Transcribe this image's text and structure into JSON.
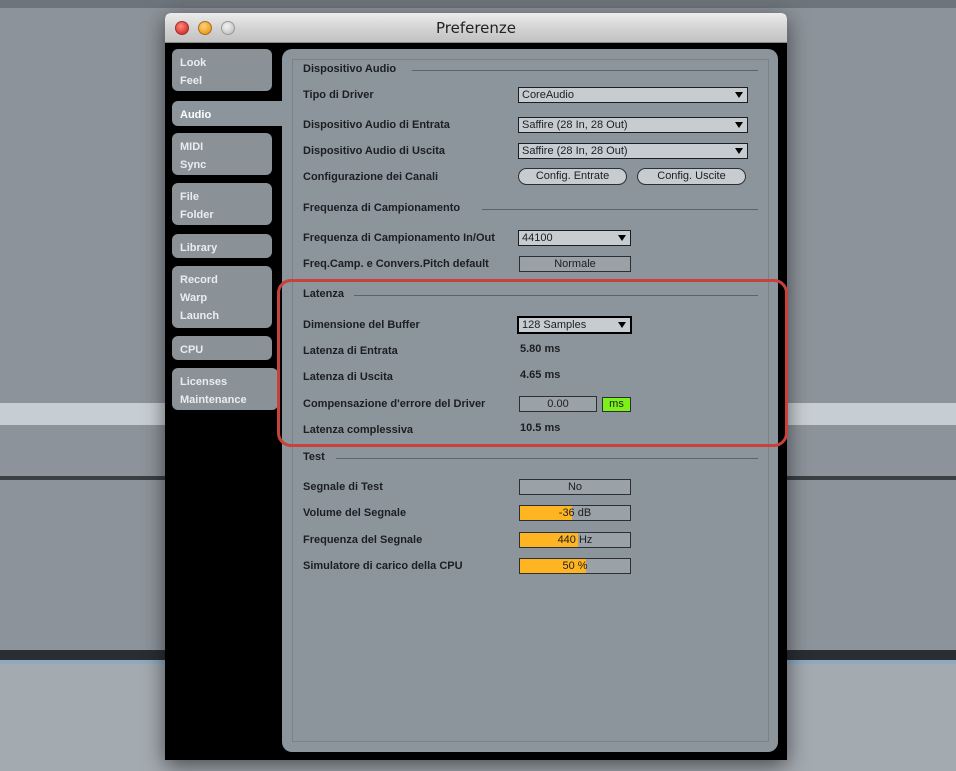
{
  "window": {
    "title": "Preferenze"
  },
  "sidebar": {
    "tabs": [
      {
        "lines": [
          "Look",
          "Feel"
        ]
      },
      {
        "lines": [
          "Audio"
        ]
      },
      {
        "lines": [
          "MIDI",
          "Sync"
        ]
      },
      {
        "lines": [
          "File",
          "Folder"
        ]
      },
      {
        "lines": [
          "Library"
        ]
      },
      {
        "lines": [
          "Record",
          "Warp",
          "Launch"
        ]
      },
      {
        "lines": [
          "CPU"
        ]
      },
      {
        "lines": [
          "Licenses"
        ]
      }
    ],
    "maintenance_label": "Maintenance",
    "active_tab": "Audio"
  },
  "device": {
    "section_title": "Dispositivo Audio",
    "driver_type_label": "Tipo di Driver",
    "driver_type_value": "CoreAudio",
    "input_device_label": "Dispositivo Audio di Entrata",
    "input_device_value": "Saffire (28 In, 28 Out)",
    "output_device_label": "Dispositivo Audio di Uscita",
    "output_device_value": "Saffire (28 In, 28 Out)",
    "channel_config_label": "Configurazione dei Canali",
    "input_config_button": "Config. Entrate",
    "output_config_button": "Config. Uscite"
  },
  "sample_rate": {
    "section_title": "Frequenza di Campionamento",
    "in_out_label": "Frequenza di Campionamento In/Out",
    "in_out_value": "44100",
    "pitch_default_label": "Freq.Camp. e Convers.Pitch default",
    "pitch_default_value": "Normale"
  },
  "latency": {
    "section_title": "Latenza",
    "buffer_label": "Dimensione del Buffer",
    "buffer_value": "128 Samples",
    "input_latency_label": "Latenza di Entrata",
    "input_latency_value": "5.80 ms",
    "output_latency_label": "Latenza di Uscita",
    "output_latency_value": "4.65 ms",
    "driver_comp_label": "Compensazione d'errore del Driver",
    "driver_comp_value": "0.00",
    "driver_comp_unit": "ms",
    "overall_label": "Latenza complessiva",
    "overall_value": "10.5 ms"
  },
  "test": {
    "section_title": "Test",
    "test_tone_label": "Segnale di Test",
    "test_tone_value": "No",
    "volume_label": "Volume del Segnale",
    "volume_value": "-36 dB",
    "volume_fill_fraction": 0.47,
    "frequency_label": "Frequenza del Segnale",
    "frequency_value": "440 Hz",
    "frequency_fill_fraction": 0.53,
    "cpu_sim_label": "Simulatore di carico della CPU",
    "cpu_sim_value": "50 %",
    "cpu_sim_fill_fraction": 0.6
  },
  "colors": {
    "highlight": "#c8413b",
    "slider_fill": "#ffb521",
    "unit_active": "#7df21a"
  }
}
